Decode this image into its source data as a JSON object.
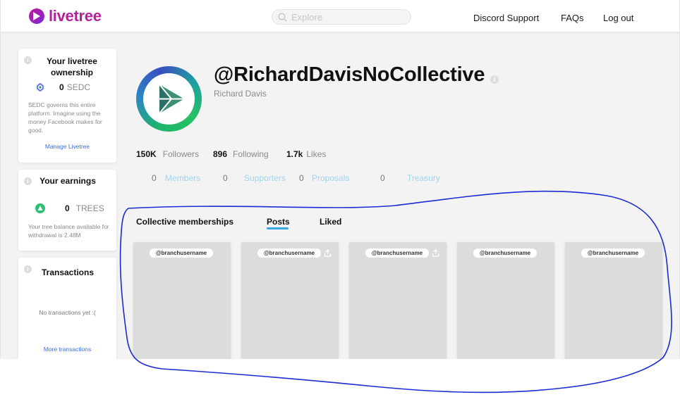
{
  "header": {
    "logo_text": "livetree",
    "search_placeholder": "Explore",
    "nav": [
      "Discord Support",
      "FAQs",
      "Log out"
    ]
  },
  "ownership_card": {
    "title": "Your livetree ownership",
    "amount": "0",
    "currency": "SEDC",
    "description": "SEDC governs this entire platform. Imagine using the money Facebook makes for good.",
    "link": "Manage Livetree"
  },
  "earnings_card": {
    "title": "Your earnings",
    "amount": "0",
    "currency": "TREES",
    "description": "Your tree balance available for withdrawal is 2.48M"
  },
  "transactions_card": {
    "title": "Transactions",
    "empty_text": "No transactions yet :(",
    "link": "More transactions"
  },
  "profile": {
    "handle": "@RichardDavisNoCollective",
    "name": "Richard Davis",
    "stats": [
      {
        "value": "150K",
        "label": "Followers"
      },
      {
        "value": "896",
        "label": "Following"
      },
      {
        "value": "1.7k",
        "label": "Likes"
      }
    ],
    "collective_stats": [
      {
        "value": "0",
        "label": "Members"
      },
      {
        "value": "0",
        "label": "Supporters"
      },
      {
        "value": "0",
        "label": "Proposals"
      },
      {
        "value": "0",
        "label": "Treasury"
      }
    ]
  },
  "tabs": [
    "Collective memberships",
    "Posts",
    "Liked"
  ],
  "active_tab": "Posts",
  "posts": [
    {
      "username": "@branchusername",
      "share_icon": false
    },
    {
      "username": "@branchusername",
      "share_icon": true
    },
    {
      "username": "@branchusername",
      "share_icon": true
    },
    {
      "username": "@branchusername",
      "share_icon": false
    },
    {
      "username": "@branchusername",
      "share_icon": false
    }
  ],
  "colors": {
    "brand": "#b4229a",
    "link": "#3d6fd6",
    "accent_tab": "#3aa6e0",
    "collective_label": "#9fd4ec",
    "annotation": "#1b2ad4"
  }
}
